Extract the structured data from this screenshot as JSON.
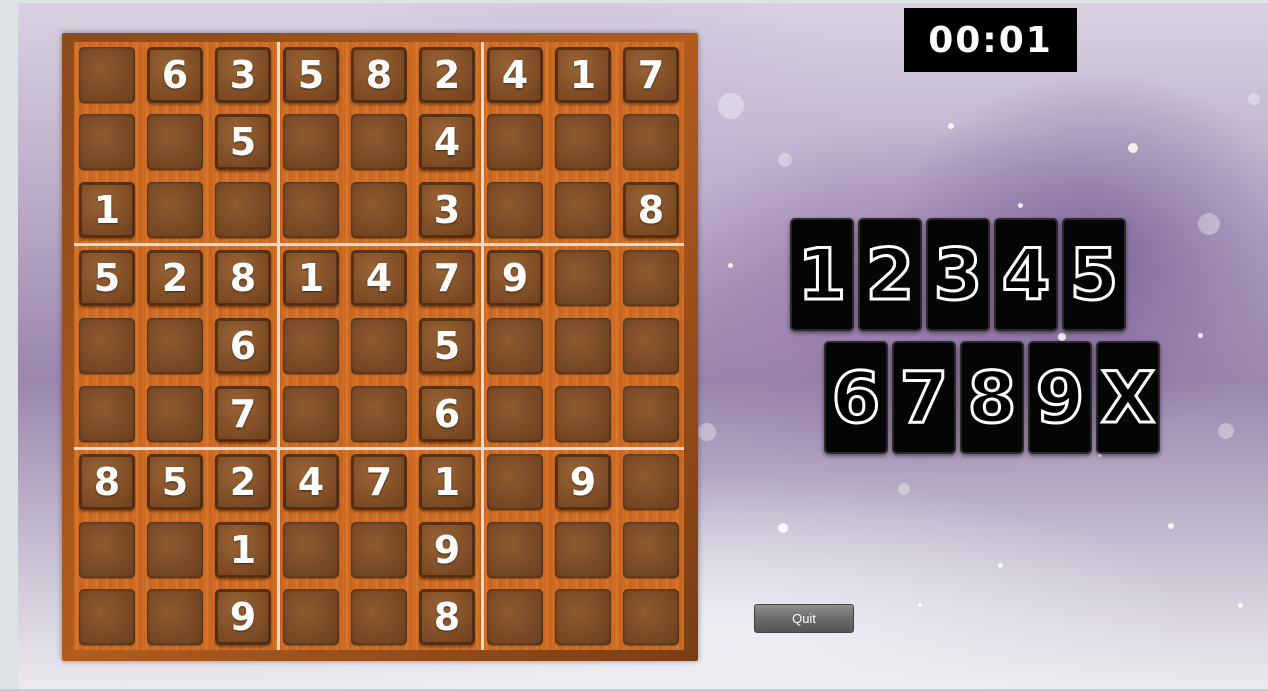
{
  "timer": {
    "text": "00:01"
  },
  "board": {
    "rows": [
      [
        "",
        "6",
        "3",
        "5",
        "8",
        "2",
        "4",
        "1",
        "7"
      ],
      [
        "",
        "",
        "5",
        "",
        "",
        "4",
        "",
        "",
        ""
      ],
      [
        "1",
        "",
        "",
        "",
        "",
        "3",
        "",
        "",
        "8"
      ],
      [
        "5",
        "2",
        "8",
        "1",
        "4",
        "7",
        "9",
        "",
        ""
      ],
      [
        "",
        "",
        "6",
        "",
        "",
        "5",
        "",
        "",
        ""
      ],
      [
        "",
        "",
        "7",
        "",
        "",
        "6",
        "",
        "",
        ""
      ],
      [
        "8",
        "5",
        "2",
        "4",
        "7",
        "1",
        "",
        "9",
        ""
      ],
      [
        "",
        "",
        "1",
        "",
        "",
        "9",
        "",
        "",
        ""
      ],
      [
        "",
        "",
        "9",
        "",
        "",
        "8",
        "",
        "",
        ""
      ]
    ]
  },
  "picker": {
    "row1": [
      "1",
      "2",
      "3",
      "4",
      "5"
    ],
    "row2": [
      "6",
      "7",
      "8",
      "9",
      "X"
    ]
  },
  "quit": {
    "label": "Quit"
  }
}
